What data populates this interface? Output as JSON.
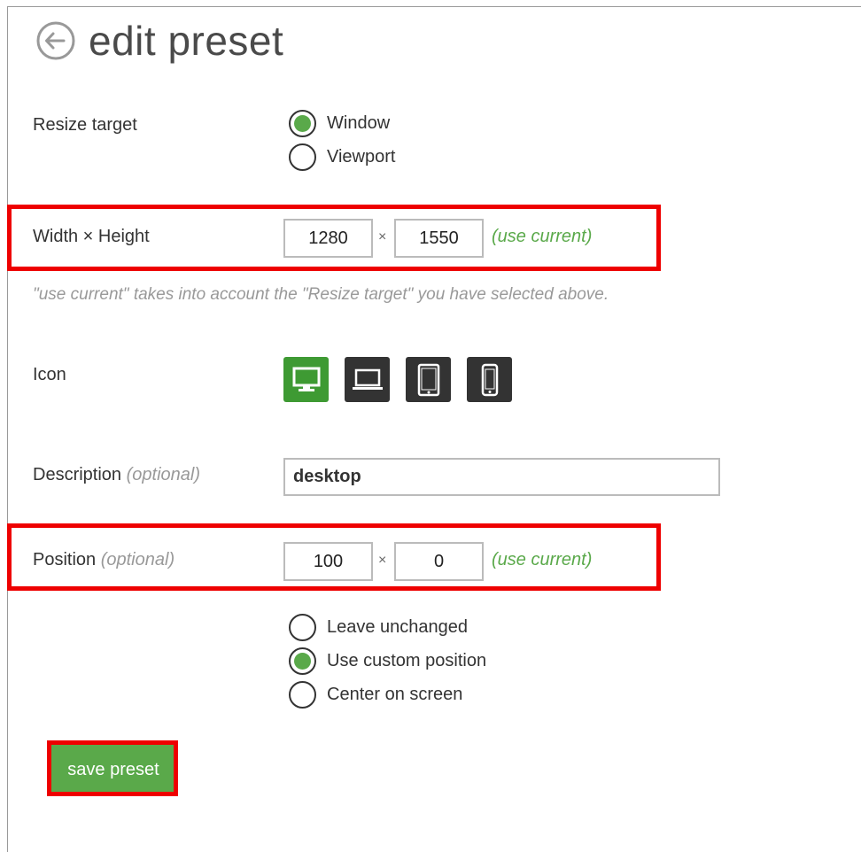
{
  "header": {
    "title": "edit preset",
    "back_icon": "arrow-left-circle-icon"
  },
  "resize_target": {
    "label": "Resize target",
    "options": [
      {
        "label": "Window",
        "selected": true
      },
      {
        "label": "Viewport",
        "selected": false
      }
    ]
  },
  "size": {
    "label": "Width × Height",
    "width": "1280",
    "height": "1550",
    "separator": "×",
    "use_current": "(use current)"
  },
  "hint": "\"use current\" takes into account the \"Resize target\" you have selected above.",
  "icon": {
    "label": "Icon",
    "options": [
      {
        "name": "desktop-icon",
        "selected": true
      },
      {
        "name": "laptop-icon",
        "selected": false
      },
      {
        "name": "tablet-icon",
        "selected": false
      },
      {
        "name": "phone-icon",
        "selected": false
      }
    ]
  },
  "description": {
    "label": "Description",
    "optional": "(optional)",
    "value": "desktop"
  },
  "position": {
    "label": "Position",
    "optional": "(optional)",
    "x": "100",
    "y": "0",
    "separator": "×",
    "use_current": "(use current)",
    "options": [
      {
        "label": "Leave unchanged",
        "selected": false
      },
      {
        "label": "Use custom position",
        "selected": true
      },
      {
        "label": "Center on screen",
        "selected": false
      }
    ]
  },
  "save_button": {
    "label": "save preset"
  },
  "colors": {
    "accent_green": "#5aa94a",
    "active_icon_bg": "#3e9a33",
    "icon_bg": "#333333",
    "highlight_red": "#ee0000"
  }
}
